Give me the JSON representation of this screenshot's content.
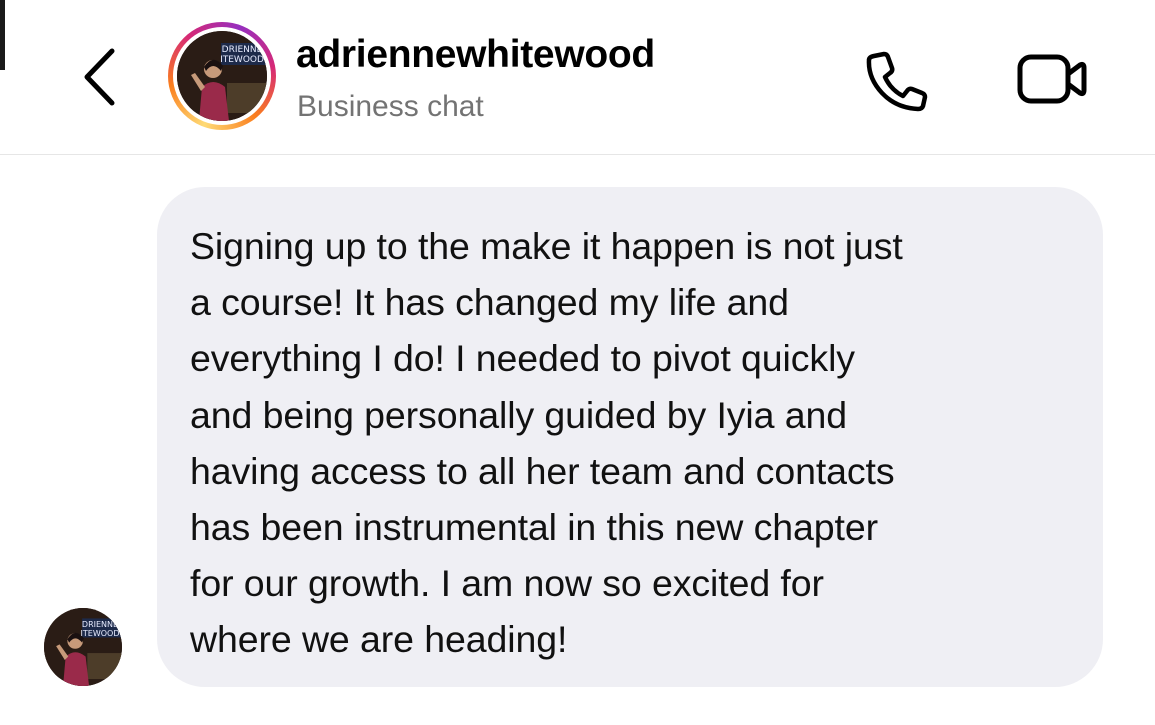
{
  "header": {
    "back_icon": "chevron-left-icon",
    "username": "adriennewhitewood",
    "subtitle": "Business chat",
    "avatar_logo_line1": "DRIENNE",
    "avatar_logo_line2": "ITEWOOD",
    "call_icon": "phone-icon",
    "video_icon": "video-camera-icon"
  },
  "message": {
    "text": "Signing up to the make it happen is not just\na course! It has changed my life and\neverything I do! I needed to pivot quickly\nand being personally guided by Iyia and\nhaving access to all her team and contacts\nhas been instrumental in this new chapter\nfor our growth. I am now so excited for\nwhere we are heading!",
    "avatar_logo_line1": "DRIENNE",
    "avatar_logo_line2": "ITEWOOD"
  },
  "colors": {
    "bubble_background": "#efeff4",
    "subtitle_gray": "#737373",
    "story_ring_gradient": [
      "#feda75",
      "#fa7e1e",
      "#d62976",
      "#962fbf"
    ]
  }
}
